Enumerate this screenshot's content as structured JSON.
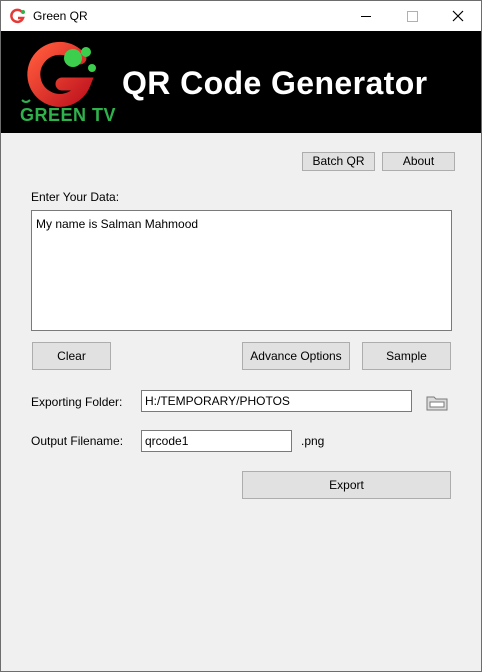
{
  "window": {
    "title": "Green QR"
  },
  "banner": {
    "brand": "GREEN TV",
    "title": "QR Code Generator"
  },
  "toolbar": {
    "batch_label": "Batch QR",
    "about_label": "About"
  },
  "data_section": {
    "label": "Enter Your Data:",
    "value": "My name is Salman Mahmood"
  },
  "actions": {
    "clear_label": "Clear",
    "advance_label": "Advance Options",
    "sample_label": "Sample"
  },
  "export": {
    "folder_label": "Exporting Folder:",
    "folder_value": "H:/TEMPORARY/PHOTOS",
    "filename_label": "Output Filename:",
    "filename_value": "qrcode1",
    "extension": ".png",
    "export_label": "Export"
  },
  "colors": {
    "brand_green": "#2fb24c",
    "brand_red": "#e53935",
    "banner_bg": "#000000"
  }
}
